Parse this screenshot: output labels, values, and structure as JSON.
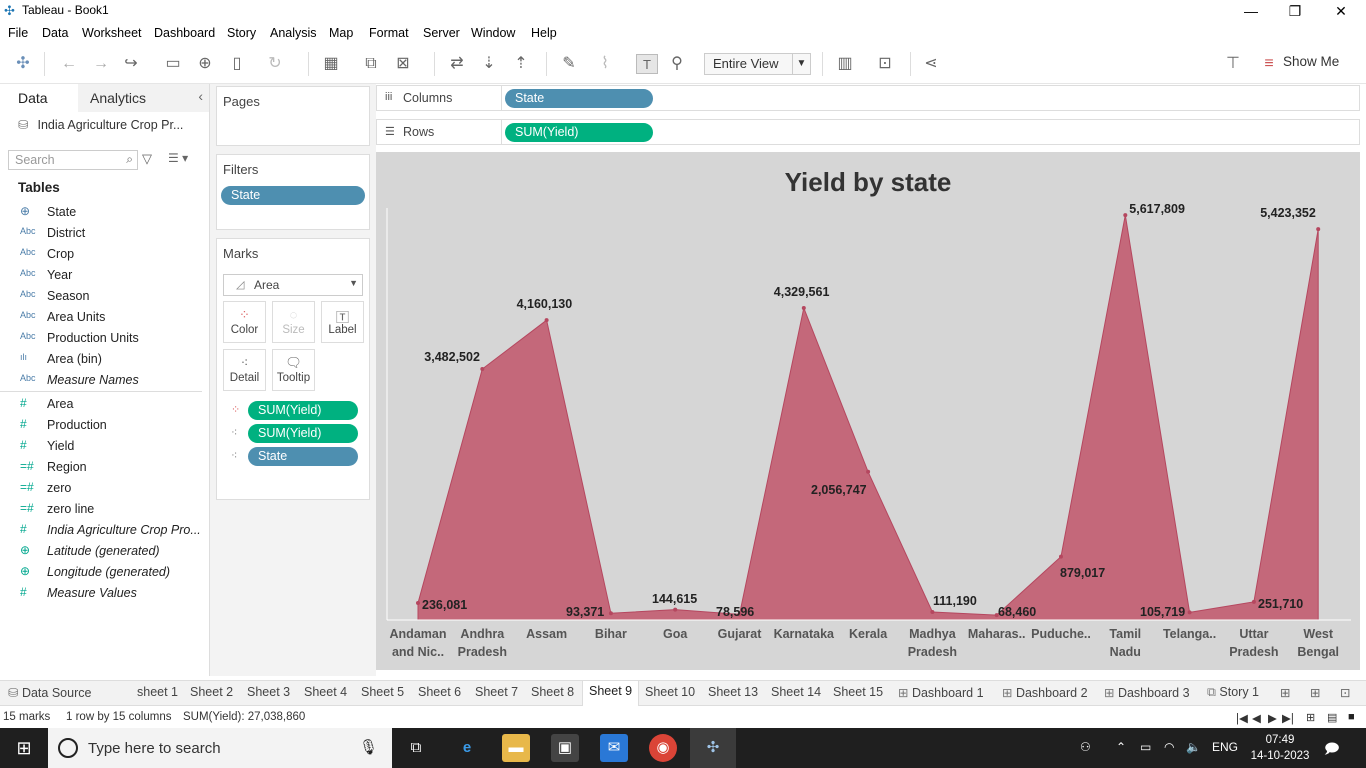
{
  "window": {
    "title": "Tableau - Book1"
  },
  "menu": [
    "File",
    "Data",
    "Worksheet",
    "Dashboard",
    "Story",
    "Analysis",
    "Map",
    "Format",
    "Server",
    "Window",
    "Help"
  ],
  "toolbar": {
    "fit": "Entire View",
    "show_me": "Show Me"
  },
  "datapane": {
    "tab_data": "Data",
    "tab_analytics": "Analytics",
    "datasource": "India Agriculture Crop Pr...",
    "search_placeholder": "Search",
    "tables_heading": "Tables",
    "dimensions": [
      {
        "type": "geo",
        "name": "State"
      },
      {
        "type": "abc",
        "name": "District"
      },
      {
        "type": "abc",
        "name": "Crop"
      },
      {
        "type": "abc",
        "name": "Year"
      },
      {
        "type": "abc",
        "name": "Season"
      },
      {
        "type": "abc",
        "name": "Area Units"
      },
      {
        "type": "abc",
        "name": "Production Units"
      },
      {
        "type": "bin",
        "name": "Area (bin)"
      },
      {
        "type": "abc",
        "name": "Measure Names",
        "italic": true
      }
    ],
    "measures": [
      {
        "type": "num",
        "name": "Area"
      },
      {
        "type": "num",
        "name": "Production"
      },
      {
        "type": "num",
        "name": "Yield"
      },
      {
        "type": "calc",
        "name": "Region"
      },
      {
        "type": "calc",
        "name": "zero"
      },
      {
        "type": "calc",
        "name": "zero line"
      },
      {
        "type": "num",
        "name": "India Agriculture Crop Pro...",
        "italic": true
      },
      {
        "type": "geo",
        "name": "Latitude (generated)",
        "italic": true
      },
      {
        "type": "geo",
        "name": "Longitude (generated)",
        "italic": true
      },
      {
        "type": "num",
        "name": "Measure Values",
        "italic": true
      }
    ],
    "icons": {
      "geo": "⊕",
      "abc": "Abc",
      "num": "#",
      "calc": "=#",
      "bin": "ılı"
    }
  },
  "cards": {
    "pages": "Pages",
    "filters": "Filters",
    "filter_pill": "State",
    "marks": "Marks",
    "mark_type": "Area",
    "buttons": [
      "Color",
      "Size",
      "Label",
      "Detail",
      "Tooltip"
    ],
    "mark_pills": [
      "SUM(Yield)",
      "SUM(Yield)",
      "State"
    ]
  },
  "shelves": {
    "columns_label": "Columns",
    "columns_pill": "State",
    "rows_label": "Rows",
    "rows_pill": "SUM(Yield)"
  },
  "chart_data": {
    "type": "area",
    "title": "Yield by state",
    "categories": [
      "Andaman and Nic..",
      "Andhra Pradesh",
      "Assam",
      "Bihar",
      "Goa",
      "Gujarat",
      "Karnataka",
      "Kerala",
      "Madhya Pradesh",
      "Maharas..",
      "Puduche..",
      "Tamil Nadu",
      "Telanga..",
      "Uttar Pradesh",
      "West Bengal"
    ],
    "category_lines": [
      [
        "Andaman",
        "and Nic.."
      ],
      [
        "Andhra",
        "Pradesh"
      ],
      [
        "Assam"
      ],
      [
        "Bihar"
      ],
      [
        "Goa"
      ],
      [
        "Gujarat"
      ],
      [
        "Karnataka"
      ],
      [
        "Kerala"
      ],
      [
        "Madhya",
        "Pradesh"
      ],
      [
        "Maharas.."
      ],
      [
        "Puduche.."
      ],
      [
        "Tamil",
        "Nadu"
      ],
      [
        "Telanga.."
      ],
      [
        "Uttar",
        "Pradesh"
      ],
      [
        "West",
        "Bengal"
      ]
    ],
    "values": [
      236081,
      3482502,
      4160130,
      93371,
      144615,
      78596,
      4329561,
      2056747,
      111190,
      68460,
      879017,
      5617809,
      105719,
      251710,
      5423352
    ],
    "labels": [
      "236,081",
      "3,482,502",
      "4,160,130",
      "93,371",
      "144,615",
      "78,596",
      "4,329,561",
      "2,056,747",
      "111,190",
      "68,460",
      "879,017",
      "5,617,809",
      "105,719",
      "251,710",
      "5,423,352"
    ],
    "ylim": [
      0,
      5800000
    ],
    "grid": false,
    "fill_color": "#c4687a",
    "line_color": "#b5475f"
  },
  "sheet_tabs": [
    "Data Source",
    "sheet 1",
    "Sheet 2",
    "Sheet 3",
    "Sheet 4",
    "Sheet 5",
    "Sheet 6",
    "Sheet 7",
    "Sheet 8",
    "Sheet 9",
    "Sheet 10",
    "Sheet 13",
    "Sheet 14",
    "Sheet 15",
    "Dashboard 1",
    "Dashboard 2",
    "Dashboard 3",
    "Story 1"
  ],
  "active_tab": "Sheet 9",
  "status": {
    "marks": "15 marks",
    "dims": "1 row by 15 columns",
    "sum": "SUM(Yield): 27,038,860"
  },
  "taskbar": {
    "search_placeholder": "Type here to search",
    "lang": "ENG",
    "time": "07:49",
    "date": "14-10-2023"
  }
}
